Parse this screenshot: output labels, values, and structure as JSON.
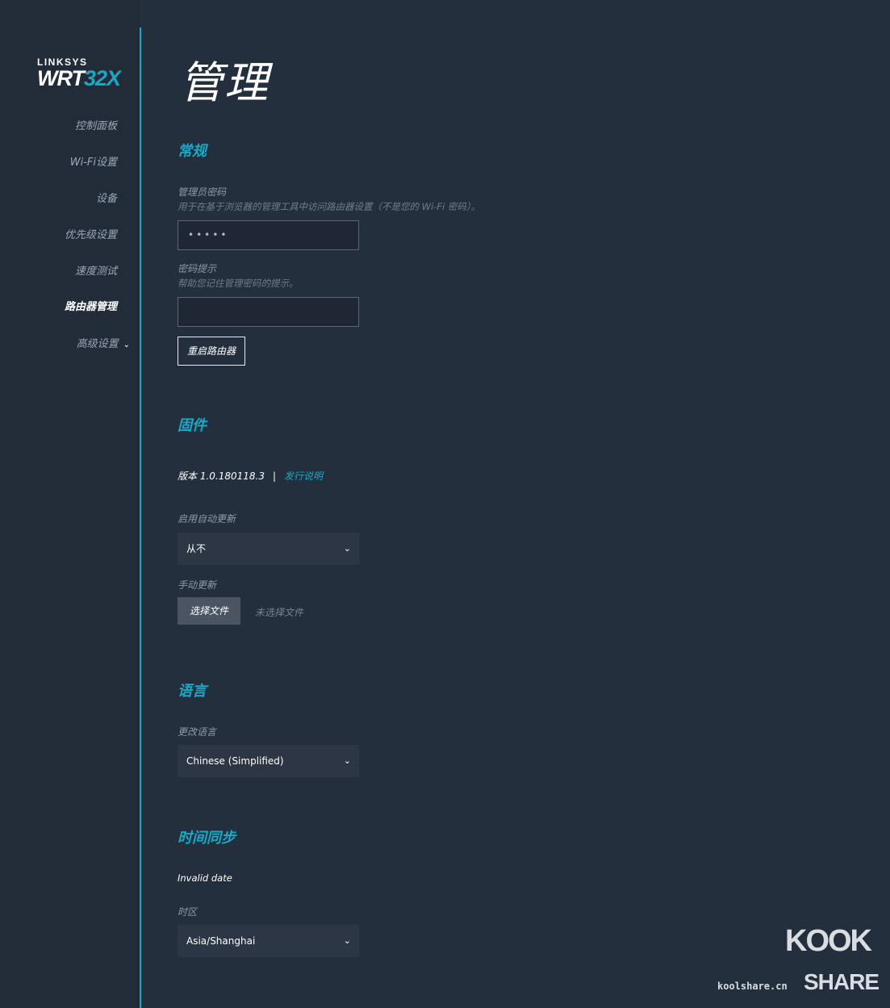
{
  "logo": {
    "brand": "LINKSYS",
    "model_main": "WRT",
    "model_accent": "32X"
  },
  "sidebar": {
    "items": [
      {
        "label": "控制面板"
      },
      {
        "label": "Wi-Fi设置"
      },
      {
        "label": "设备"
      },
      {
        "label": "优先级设置"
      },
      {
        "label": "速度测试"
      },
      {
        "label": "路由器管理",
        "active": true
      },
      {
        "label": "高级设置"
      }
    ]
  },
  "page": {
    "title": "管理"
  },
  "general": {
    "title": "常规",
    "admin_password_label": "管理员密码",
    "admin_password_hint": "用于在基于浏览器的管理工具中访问路由器设置（不是您的 Wi-Fi 密码）。",
    "admin_password_value": "•••••",
    "password_hint_label": "密码提示",
    "password_hint_hint": "帮助您记住管理密码的提示。",
    "password_hint_value": "",
    "reboot_label": "重启路由器"
  },
  "firmware": {
    "title": "固件",
    "version": "版本 1.0.180118.3",
    "separator": "|",
    "release_notes": "发行说明",
    "auto_update_label": "启用自动更新",
    "auto_update_value": "从不",
    "manual_update_label": "手动更新",
    "choose_file_label": "选择文件",
    "no_file_label": "未选择文件"
  },
  "language": {
    "title": "语言",
    "change_label": "更改语言",
    "value": "Chinese (Simplified)"
  },
  "time_sync": {
    "title": "时间同步",
    "date_text": "Invalid date",
    "timezone_label": "时区",
    "timezone_value": "Asia/Shanghai"
  },
  "watermark": {
    "site": "koolshare.cn",
    "kook": "KOOK",
    "share": "SHARE"
  },
  "colors": {
    "accent": "#19a9c8",
    "background": "#242f3d",
    "sidebar": "#222c39"
  }
}
